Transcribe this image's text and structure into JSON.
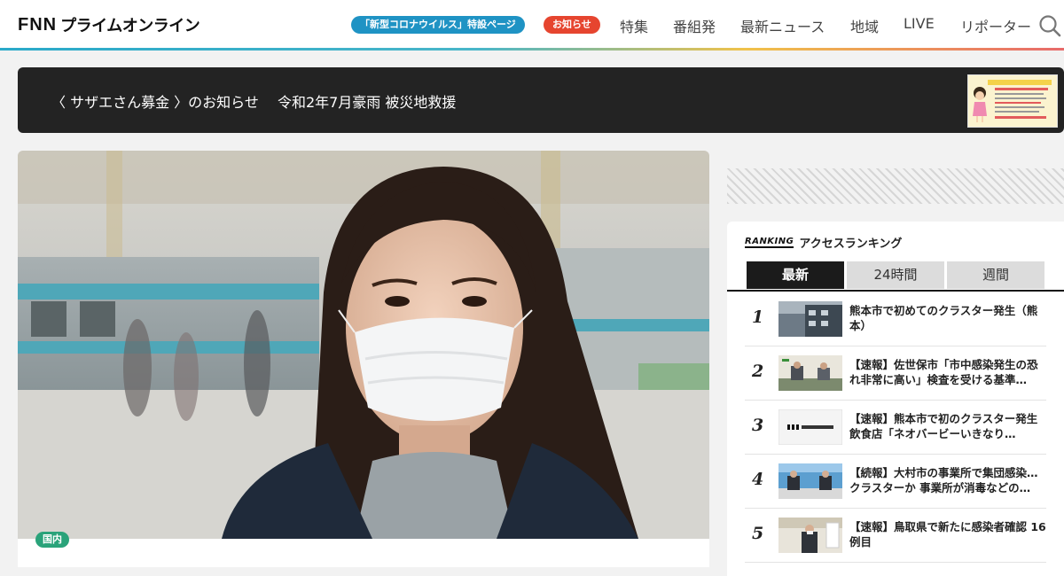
{
  "header": {
    "logo_letters": [
      "F",
      "N",
      "N"
    ],
    "logo_text": "プライムオンライン",
    "covid_pill": "「新型コロナウイルス」特設ページ",
    "notice_pill": "お知らせ",
    "nav": [
      "特集",
      "番組発",
      "最新ニュース",
      "地域",
      "LIVE",
      "リポーター"
    ],
    "search_icon": "search-icon"
  },
  "banner": {
    "text": "〈 サザエさん募金 〉のお知らせ　 令和2年7月豪雨 被災地救援"
  },
  "article": {
    "category": "国内"
  },
  "ranking": {
    "label_en": "RANKING",
    "title": "アクセスランキング",
    "tabs": [
      "最新",
      "24時間",
      "週間"
    ],
    "active_tab": 0,
    "items": [
      {
        "rank": "1",
        "title": "熊本市で初めてのクラスター発生（熊本）"
      },
      {
        "rank": "2",
        "title": "【速報】佐世保市「市中感染発生の恐れ非常に高い」検査を受ける基準…"
      },
      {
        "rank": "3",
        "title": "【速報】熊本市で初のクラスター発生　飲食店「ネオバービーいきなり…"
      },
      {
        "rank": "4",
        "title": "【続報】大村市の事業所で集団感染…クラスターか 事業所が消毒などの…"
      },
      {
        "rank": "5",
        "title": "【速報】鳥取県で新たに感染者確認 16例目"
      }
    ]
  },
  "colors": {
    "covid": "#1f93c4",
    "notice": "#e6452f",
    "category": "#2aa37a",
    "banner_bg": "#232323"
  }
}
